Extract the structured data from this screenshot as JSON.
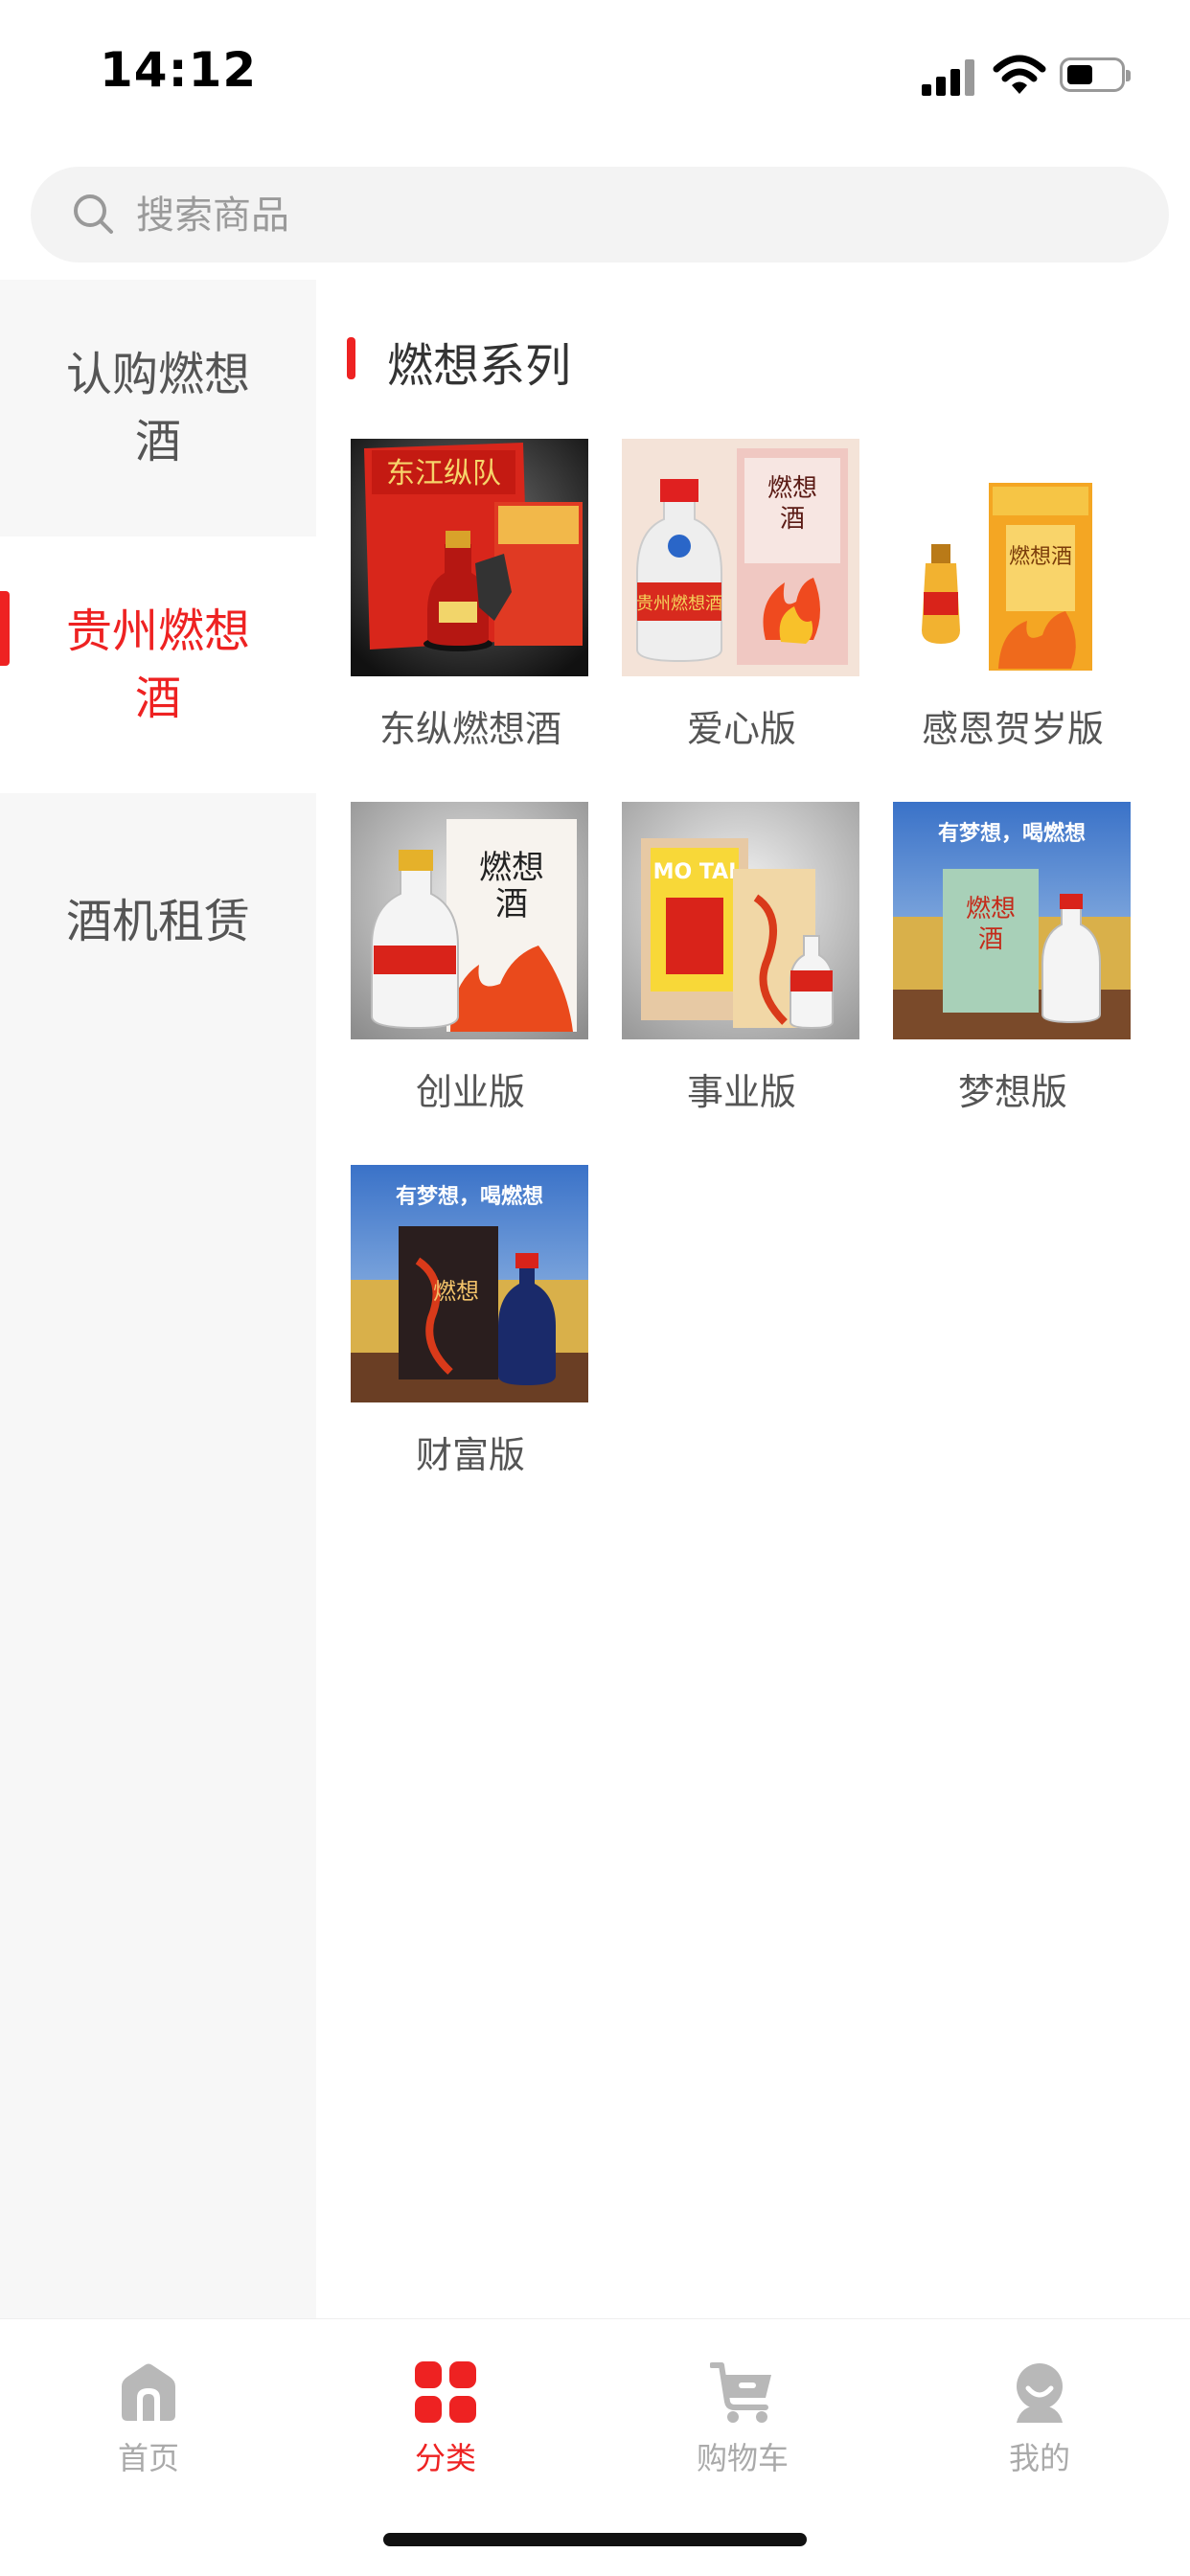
{
  "status_bar": {
    "time": "14:12"
  },
  "search": {
    "placeholder": "搜索商品"
  },
  "sidebar": {
    "items": [
      {
        "label": "认购燃想酒",
        "active": false
      },
      {
        "label": "贵州燃想酒",
        "active": true
      },
      {
        "label": "酒机租赁",
        "active": false
      }
    ]
  },
  "content": {
    "section_title": "燃想系列",
    "products": [
      {
        "name": "东纵燃想酒"
      },
      {
        "name": "爱心版"
      },
      {
        "name": "感恩贺岁版"
      },
      {
        "name": "创业版"
      },
      {
        "name": "事业版"
      },
      {
        "name": "梦想版"
      },
      {
        "name": "财富版"
      }
    ],
    "image_text": {
      "dongzong_box": "东江纵队",
      "label_ranxiang": "燃想酒",
      "moutai_brand": "MO TAI",
      "slogan": "有梦想，喝燃想"
    }
  },
  "tab_bar": {
    "tabs": [
      {
        "label": "首页",
        "icon": "home-icon",
        "active": false
      },
      {
        "label": "分类",
        "icon": "category-grid-icon",
        "active": true
      },
      {
        "label": "购物车",
        "icon": "cart-icon",
        "active": false
      },
      {
        "label": "我的",
        "icon": "profile-icon",
        "active": false
      }
    ]
  },
  "colors": {
    "accent": "#ee2222",
    "sidebar_bg": "#f7f7f7",
    "tab_inactive": "#aaaaaa"
  }
}
